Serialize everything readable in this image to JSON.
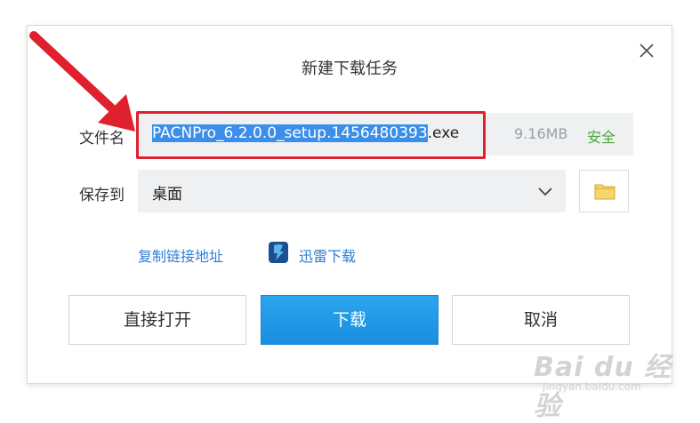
{
  "dialog": {
    "title": "新建下载任务",
    "file": {
      "label": "文件名",
      "name_selected": "PACNPro_6.2.0.0_setup.1456480393",
      "extension": ".exe",
      "size": "9.16MB",
      "safety": "安全"
    },
    "save": {
      "label": "保存到",
      "location": "桌面"
    },
    "links": {
      "copy_link": "复制链接地址",
      "thunder": "迅雷下载"
    },
    "buttons": {
      "open": "直接打开",
      "download": "下载",
      "cancel": "取消"
    }
  },
  "watermark": {
    "brand": "Bai du 经验",
    "url": "jingyan.baidu.com"
  },
  "colors": {
    "accent": "#1a8de0",
    "highlight_border": "#e0202f",
    "safe": "#4aa83a",
    "link": "#2d7fd6"
  }
}
